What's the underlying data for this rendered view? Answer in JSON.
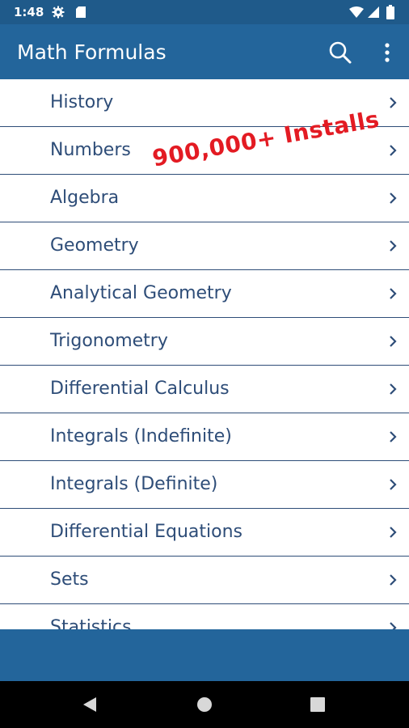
{
  "status_bar": {
    "time": "1:48",
    "icons": [
      "gear-icon",
      "sd-card-icon",
      "wifi-icon",
      "signal-icon",
      "battery-icon"
    ]
  },
  "app_bar": {
    "title": "Math Formulas",
    "actions": [
      "search-icon",
      "more-vert-icon"
    ]
  },
  "promo": {
    "text": "900,000+ Installs",
    "color": "#e31b23"
  },
  "list": {
    "items": [
      {
        "label": "History"
      },
      {
        "label": "Numbers"
      },
      {
        "label": "Algebra"
      },
      {
        "label": "Geometry"
      },
      {
        "label": "Analytical Geometry"
      },
      {
        "label": "Trigonometry"
      },
      {
        "label": "Differential Calculus"
      },
      {
        "label": "Integrals (Indefinite)"
      },
      {
        "label": "Integrals (Definite)"
      },
      {
        "label": "Differential Equations"
      },
      {
        "label": "Sets"
      },
      {
        "label": "Statistics"
      }
    ],
    "text_color": "#2e4d78"
  },
  "nav_bar": {
    "buttons": [
      "back-icon",
      "home-icon",
      "recents-icon"
    ]
  },
  "colors": {
    "status_bar": "#1f5a8a",
    "app_bar": "#23659b",
    "nav_bar": "#000000"
  }
}
